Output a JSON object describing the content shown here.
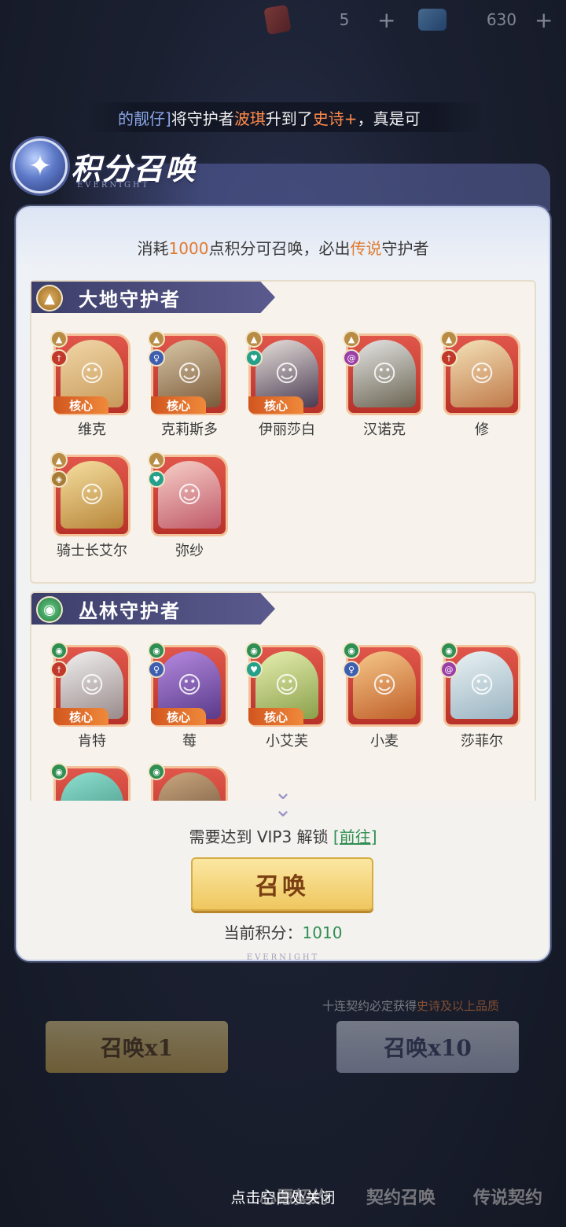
{
  "resources": [
    {
      "icon": "ticket-icon",
      "value": "5"
    },
    {
      "icon": "crystal-icon",
      "value": "630"
    }
  ],
  "marquee": {
    "name": "的靓仔]",
    "text1": "将守护者",
    "hero": "波琪",
    "text2": "升到了",
    "rank": "史诗+",
    "text3": "，真是",
    "tail": "可"
  },
  "title": {
    "main": "积分召唤",
    "sub": "EVERNIGHT"
  },
  "description": {
    "prefix": "消耗",
    "amount": "1000",
    "mid": "点积分可召唤，必出",
    "legend": "传说",
    "suffix": "守护者"
  },
  "sections": {
    "earth": {
      "title": "大地守护者",
      "heroes": [
        {
          "name": "维克",
          "core": "核心"
        },
        {
          "name": "克莉斯多",
          "core": "核心"
        },
        {
          "name": "伊丽莎白",
          "core": "核心"
        },
        {
          "name": "汉诺克",
          "core": ""
        },
        {
          "name": "修",
          "core": ""
        },
        {
          "name": "骑士长艾尔",
          "core": ""
        },
        {
          "name": "弥纱",
          "core": ""
        }
      ]
    },
    "jungle": {
      "title": "丛林守护者",
      "heroes": [
        {
          "name": "肯特",
          "core": "核心"
        },
        {
          "name": "莓",
          "core": "核心"
        },
        {
          "name": "小艾芙",
          "core": "核心"
        },
        {
          "name": "小麦",
          "core": ""
        },
        {
          "name": "莎菲尔",
          "core": ""
        }
      ]
    }
  },
  "unlock": {
    "text": "需要达到 VIP3 解锁",
    "link": "[前往]"
  },
  "summon_button": "召唤",
  "points": {
    "label": "当前积分：",
    "value": "1010"
  },
  "footer_brand": "EVERNIGHT",
  "background": {
    "note_prefix": "十连契约必定获得",
    "note_highlight": "史诗及以上品质",
    "btn1": "召唤x1",
    "btn2": "召唤x10",
    "tabs": [
      "心愿契约",
      "契约召唤",
      "传说契约"
    ]
  },
  "close_hint": "点击空白处关闭"
}
